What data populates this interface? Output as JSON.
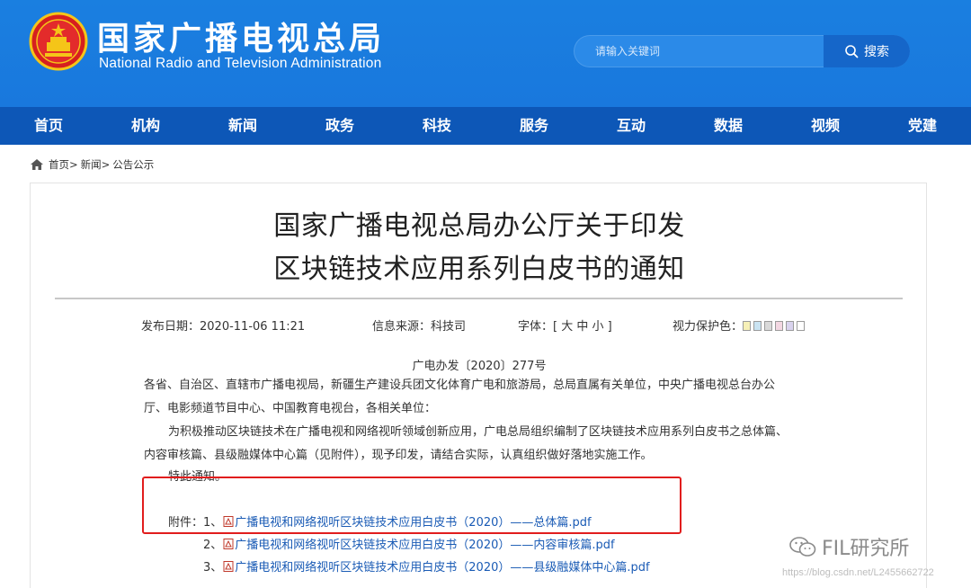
{
  "header": {
    "title": "国家广播电视总局",
    "subtitle": "National Radio and Television Administration",
    "emblem_icon": "national-emblem-icon",
    "search": {
      "placeholder": "请输入关键词",
      "button_label": "搜索",
      "button_icon": "search-icon"
    }
  },
  "nav": {
    "items": [
      {
        "label": "首页"
      },
      {
        "label": "机构"
      },
      {
        "label": "新闻"
      },
      {
        "label": "政务"
      },
      {
        "label": "科技"
      },
      {
        "label": "服务"
      },
      {
        "label": "互动"
      },
      {
        "label": "数据"
      },
      {
        "label": "视频"
      },
      {
        "label": "党建"
      }
    ]
  },
  "breadcrumb": {
    "home_icon": "home-icon",
    "items": [
      "首页>",
      "新闻>",
      "公告公示"
    ]
  },
  "article": {
    "title_line1": "国家广播电视总局办公厅关于印发",
    "title_line2": "区块链技术应用系列白皮书的通知",
    "meta": {
      "date_label": "发布日期：2020-11-06 11:21",
      "source_label": "信息来源：科技司",
      "font_label": "字体：[ 大 中 小 ]",
      "eye_label": "视力保护色：",
      "eye_colors": [
        "#f6f0b7",
        "#c9e3f2",
        "#d9d9d9",
        "#f3d7e2",
        "#d9d3ee",
        "#ffffff"
      ]
    },
    "doc_no": "广电办发〔2020〕277号",
    "recipients_line1": "各省、自治区、直辖市广播电视局，新疆生产建设兵团文化体育广电和旅游局，总局直属有关单位，中央广播电视总台办公",
    "recipients_line2": "厅、电影频道节目中心、中国教育电视台，各相关单位：",
    "body_line1": "为积极推动区块链技术在广播电视和网络视听领域创新应用，广电总局组织编制了区块链技术应用系列白皮书之总体篇、",
    "body_line2": "内容审核篇、县级融媒体中心篇（见附件），现予印发，请结合实际，认真组织做好落地实施工作。",
    "closing": "特此通知。",
    "attachments_label": "附件：",
    "attachments": [
      {
        "num": "1、",
        "name": "广播电视和网络视听区块链技术应用白皮书（2020）——总体篇.pdf"
      },
      {
        "num": "2、",
        "name": "广播电视和网络视听区块链技术应用白皮书（2020）——内容审核篇.pdf"
      },
      {
        "num": "3、",
        "name": "广播电视和网络视听区块链技术应用白皮书（2020）——县级融媒体中心篇.pdf"
      }
    ]
  },
  "watermark": {
    "brand": "FIL研究所",
    "url": "https://blog.csdn.net/L2455662722"
  },
  "colors": {
    "header_bg": "#1a7fe0",
    "nav_bg": "#0d57b7",
    "link": "#1a5bb5",
    "highlight_box": "#e11d1d"
  }
}
